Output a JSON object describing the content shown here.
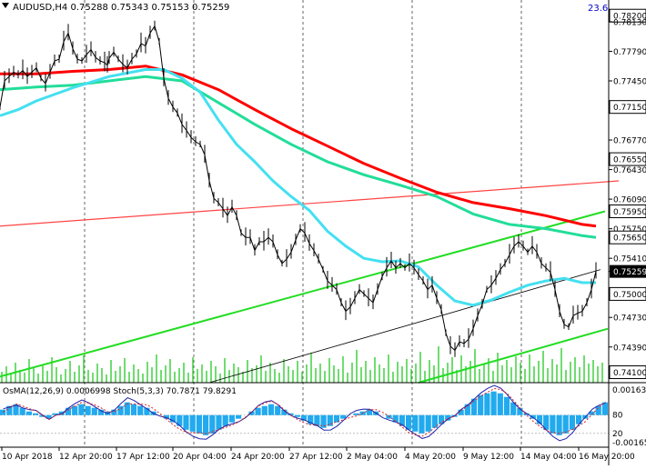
{
  "header": {
    "symbol_line": "AUDUSD,H4  0.75288 0.75343 0.75153 0.75259",
    "corner_value": "23.6"
  },
  "colors": {
    "ema_fast": "#ff0000",
    "ema_mid": "#22dd99",
    "ema_slow": "#44e0f0",
    "trend_green": "#22dd22",
    "trend_red": "#ff4444",
    "volume": "#33cc33",
    "price_line": "#000000",
    "osma_bars": "#22aaee",
    "stoch_main": "#2222aa",
    "stoch_signal": "#dd2222",
    "price_box_bg": "#000000",
    "label_box_bg": "#ffffff"
  },
  "chart_data": [
    {
      "type": "line",
      "title": "AUDUSD,H4",
      "ohlc_last": {
        "open": 0.75288,
        "high": 0.75343,
        "low": 0.75153,
        "close": 0.75259
      },
      "ylim": [
        0.7398,
        0.7838
      ],
      "y_ticks": [
        {
          "value": 0.782,
          "label": "0.78200",
          "boxed": true
        },
        {
          "value": 0.7813,
          "label": "0.78130"
        },
        {
          "value": 0.7779,
          "label": "0.77790"
        },
        {
          "value": 0.7745,
          "label": "0.77450"
        },
        {
          "value": 0.7715,
          "label": "0.77150",
          "boxed": true
        },
        {
          "value": 0.7677,
          "label": "0.76770"
        },
        {
          "value": 0.7655,
          "label": "0.76550",
          "boxed": true
        },
        {
          "value": 0.7643,
          "label": "0.76430"
        },
        {
          "value": 0.7609,
          "label": "0.76090"
        },
        {
          "value": 0.7595,
          "label": "0.75950",
          "boxed": true
        },
        {
          "value": 0.7575,
          "label": "0.75750"
        },
        {
          "value": 0.7565,
          "label": "0.75650",
          "boxed": true
        },
        {
          "value": 0.7541,
          "label": "0.75410"
        },
        {
          "value": 0.75259,
          "label": "0.75259",
          "current": true
        },
        {
          "value": 0.75,
          "label": "0.75000",
          "boxed": true
        },
        {
          "value": 0.7473,
          "label": "0.74730"
        },
        {
          "value": 0.7439,
          "label": "0.74390"
        },
        {
          "value": 0.741,
          "label": "0.74100",
          "boxed": true
        }
      ],
      "x_labels": [
        "10 Apr 2018",
        "12 Apr 20:00",
        "17 Apr 12:00",
        "20 Apr 04:00",
        "24 Apr 20:00",
        "27 Apr 12:00",
        "2 May 04:00",
        "4 May 20:00",
        "9 May 12:00",
        "14 May 04:00",
        "16 May 20:00"
      ],
      "price": {
        "name": "AUDUSD",
        "x": [
          0,
          5,
          10,
          15,
          20,
          25,
          30,
          35,
          40,
          45,
          50,
          55,
          60,
          65,
          70,
          75,
          80,
          85,
          90,
          95,
          100,
          105,
          110,
          115,
          118,
          120,
          125,
          130,
          135,
          140,
          145,
          150,
          155,
          160,
          165,
          170,
          175,
          180,
          185,
          190,
          195,
          200,
          205,
          210,
          215,
          220,
          225,
          230,
          235,
          240,
          245,
          250,
          255,
          260,
          265,
          270,
          275,
          280,
          285,
          290,
          295,
          300,
          305,
          310,
          315,
          320,
          325,
          330,
          335,
          340,
          345,
          350,
          355,
          360,
          365,
          370,
          375,
          380,
          385,
          390,
          395,
          400,
          405,
          410,
          415,
          420,
          425,
          430,
          435,
          440,
          445,
          450,
          455,
          460,
          465,
          470,
          475,
          480,
          485,
          490,
          495,
          500,
          505,
          510,
          515,
          520,
          525,
          530,
          535,
          540,
          545,
          550,
          555,
          560,
          565,
          570,
          575,
          580,
          585,
          590,
          595,
          600,
          605,
          610,
          615,
          620,
          625,
          630,
          635,
          640,
          645,
          650,
          655
        ],
        "values": [
          0.7715,
          0.7745,
          0.775,
          0.7755,
          0.7752,
          0.7757,
          0.775,
          0.7755,
          0.776,
          0.7748,
          0.7742,
          0.7755,
          0.7768,
          0.777,
          0.779,
          0.78,
          0.7782,
          0.777,
          0.7768,
          0.7775,
          0.7781,
          0.7772,
          0.7768,
          0.7766,
          0.7763,
          0.7771,
          0.7778,
          0.777,
          0.7764,
          0.776,
          0.777,
          0.7776,
          0.7788,
          0.7785,
          0.78,
          0.7808,
          0.779,
          0.7748,
          0.7725,
          0.7715,
          0.7708,
          0.7695,
          0.7688,
          0.768,
          0.7675,
          0.7672,
          0.766,
          0.763,
          0.761,
          0.7605,
          0.7598,
          0.759,
          0.76,
          0.759,
          0.757,
          0.7565,
          0.7565,
          0.755,
          0.756,
          0.756,
          0.7565,
          0.756,
          0.7545,
          0.7535,
          0.754,
          0.7548,
          0.7562,
          0.7575,
          0.757,
          0.7558,
          0.755,
          0.754,
          0.7528,
          0.7515,
          0.751,
          0.7505,
          0.749,
          0.748,
          0.7485,
          0.7495,
          0.7505,
          0.75,
          0.7495,
          0.749,
          0.7505,
          0.752,
          0.753,
          0.7538,
          0.753,
          0.7535,
          0.753,
          0.7535,
          0.753,
          0.7522,
          0.7515,
          0.7505,
          0.751,
          0.7495,
          0.7482,
          0.7455,
          0.744,
          0.7435,
          0.7445,
          0.7443,
          0.7448,
          0.746,
          0.7475,
          0.7488,
          0.7505,
          0.751,
          0.7518,
          0.7528,
          0.7535,
          0.7545,
          0.7555,
          0.756,
          0.7555,
          0.7548,
          0.7555,
          0.7548,
          0.7535,
          0.753,
          0.7525,
          0.7505,
          0.748,
          0.7465,
          0.7462,
          0.7475,
          0.7478,
          0.748,
          0.749,
          0.7505,
          0.7526
        ]
      },
      "series": [
        {
          "color_key": "ema_fast",
          "x": [
            0,
            40,
            80,
            120,
            160,
            200,
            240,
            280,
            320,
            360,
            400,
            440,
            480,
            520,
            560,
            600,
            640,
            655
          ],
          "values": [
            0.7753,
            0.7753,
            0.7756,
            0.7758,
            0.7762,
            0.7752,
            0.7735,
            0.7712,
            0.769,
            0.767,
            0.765,
            0.7633,
            0.7617,
            0.7605,
            0.7598,
            0.759,
            0.758,
            0.7578
          ]
        },
        {
          "color_key": "ema_mid",
          "x": [
            0,
            40,
            80,
            120,
            160,
            200,
            240,
            280,
            320,
            360,
            400,
            440,
            480,
            520,
            560,
            600,
            640,
            655
          ],
          "values": [
            0.7735,
            0.7738,
            0.774,
            0.7745,
            0.775,
            0.7745,
            0.772,
            0.7695,
            0.7672,
            0.7652,
            0.7637,
            0.7625,
            0.7612,
            0.7592,
            0.758,
            0.7575,
            0.7567,
            0.7565
          ]
        },
        {
          "color_key": "ema_slow",
          "x": [
            0,
            20,
            40,
            80,
            120,
            160,
            180,
            200,
            220,
            240,
            260,
            280,
            300,
            320,
            340,
            360,
            380,
            400,
            420,
            440,
            460,
            480,
            500,
            520,
            540,
            560,
            580,
            600,
            620,
            640,
            655
          ],
          "values": [
            0.7705,
            0.7712,
            0.7722,
            0.7737,
            0.775,
            0.7758,
            0.7758,
            0.7748,
            0.7732,
            0.77,
            0.7672,
            0.7652,
            0.763,
            0.7612,
            0.7596,
            0.7572,
            0.7555,
            0.7541,
            0.7537,
            0.7538,
            0.7531,
            0.751,
            0.7492,
            0.7487,
            0.7493,
            0.7502,
            0.751,
            0.7515,
            0.7518,
            0.7513,
            0.7513
          ]
        }
      ],
      "trendlines": [
        {
          "color_key": "trend_red",
          "x": [
            0,
            680
          ],
          "values": [
            0.7578,
            0.763
          ],
          "width": 1.2
        },
        {
          "color_key": "trend_green",
          "x": [
            0,
            665
          ],
          "values": [
            0.7405,
            0.7595
          ],
          "width": 2
        },
        {
          "color_key": "trend_green",
          "x": [
            460,
            668
          ],
          "values": [
            0.7398,
            0.746
          ],
          "width": 2
        },
        {
          "color_key": "price_line",
          "x": [
            230,
            660
          ],
          "values": [
            0.7398,
            0.7528
          ],
          "width": 0.8
        }
      ],
      "volume": [
        12,
        18,
        9,
        22,
        14,
        11,
        26,
        16,
        10,
        20,
        13,
        28,
        17,
        9,
        15,
        24,
        12,
        19,
        30,
        14,
        11,
        21,
        16,
        9,
        25,
        13,
        18,
        27,
        12,
        20,
        15,
        10,
        23,
        17,
        31,
        14,
        19,
        26,
        12,
        16,
        22,
        11,
        28,
        15,
        20,
        13,
        24,
        18,
        10,
        27,
        14,
        21,
        17,
        12,
        25,
        16,
        19,
        30,
        13,
        22,
        15,
        11,
        26,
        18,
        14,
        24,
        12,
        20,
        33,
        16,
        21,
        13,
        27,
        19,
        15,
        29,
        11,
        22,
        36,
        17,
        24,
        14,
        28,
        20,
        16,
        31,
        12,
        23,
        18,
        26,
        15,
        21,
        34,
        13,
        25,
        19,
        40,
        16,
        22,
        28,
        14,
        30,
        18,
        24,
        37,
        15,
        21,
        27,
        13,
        33,
        19,
        25,
        17,
        29,
        22,
        15,
        31,
        18,
        24,
        35,
        16,
        26,
        20,
        38,
        14,
        23,
        28,
        17,
        30,
        21,
        25,
        18,
        22
      ]
    },
    {
      "type": "bar",
      "title": "OsMA(12,26,9) 0.0006998  Stoch(5,3,3) 70.7871 79.8291",
      "ylim": [
        -0.001657,
        0.001632
      ],
      "y_ticks": [
        {
          "value": 0.001632,
          "label": "0.001632"
        },
        {
          "value": 0.0,
          "label": "80"
        },
        {
          "value": -0.001,
          "label": "20"
        },
        {
          "value": -0.001657,
          "label": "-0.001657"
        }
      ],
      "osma": [
        0.0003,
        0.0005,
        0.0006,
        0.0004,
        0.0002,
        0.0001,
        -0.0001,
        -0.0002,
        0.0001,
        0.0002,
        0.0004,
        0.0005,
        0.0006,
        0.0005,
        0.0004,
        0.0003,
        0.0002,
        0.0003,
        0.0005,
        0.0007,
        0.0006,
        0.0005,
        0.0004,
        0.0002,
        0.0,
        -0.0002,
        -0.0004,
        -0.0006,
        -0.0008,
        -0.0009,
        -0.001,
        -0.0011,
        -0.001,
        -0.0008,
        -0.0006,
        -0.0004,
        -0.0002,
        0.0,
        0.0002,
        0.0004,
        0.0005,
        0.0006,
        0.0005,
        0.0003,
        0.0001,
        -0.0001,
        -0.0003,
        -0.0005,
        -0.0006,
        -0.0007,
        -0.0006,
        -0.0004,
        -0.0002,
        0.0,
        0.0001,
        0.0002,
        0.0003,
        0.0002,
        0.0,
        -0.0002,
        -0.0004,
        -0.0006,
        -0.0008,
        -0.0009,
        -0.001,
        -0.0009,
        -0.0007,
        -0.0005,
        -0.0003,
        -0.0001,
        0.0003,
        0.0006,
        0.0009,
        0.0011,
        0.0012,
        0.0013,
        0.0012,
        0.001,
        0.0007,
        0.0004,
        0.0001,
        -0.0002,
        -0.0005,
        -0.0008,
        -0.001,
        -0.0011,
        -0.001,
        -0.0008,
        -0.0005,
        -0.0002,
        0.0002,
        0.0005,
        0.0007
      ]
    }
  ]
}
